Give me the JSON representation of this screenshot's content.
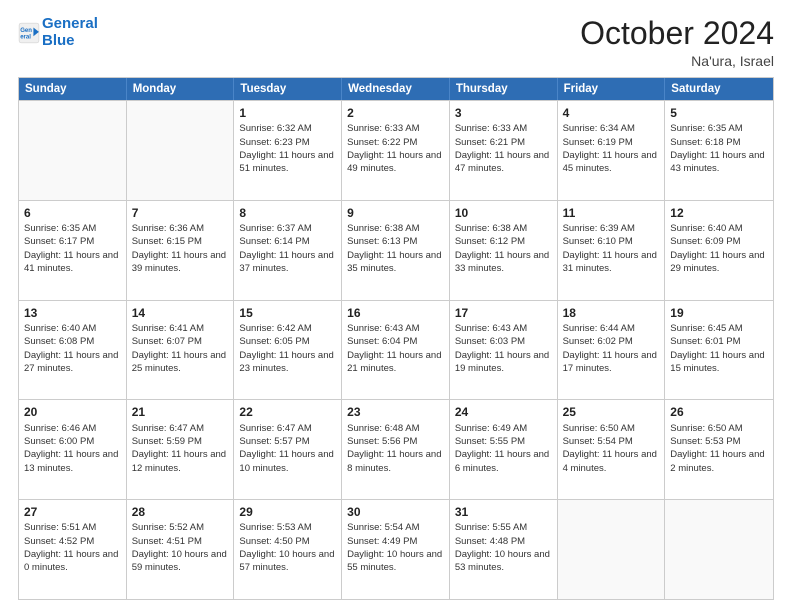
{
  "logo": {
    "line1": "General",
    "line2": "Blue"
  },
  "header": {
    "month": "October 2024",
    "location": "Na'ura, Israel"
  },
  "weekdays": [
    "Sunday",
    "Monday",
    "Tuesday",
    "Wednesday",
    "Thursday",
    "Friday",
    "Saturday"
  ],
  "weeks": [
    [
      {
        "day": "",
        "sunrise": "",
        "sunset": "",
        "daylight": ""
      },
      {
        "day": "",
        "sunrise": "",
        "sunset": "",
        "daylight": ""
      },
      {
        "day": "1",
        "sunrise": "Sunrise: 6:32 AM",
        "sunset": "Sunset: 6:23 PM",
        "daylight": "Daylight: 11 hours and 51 minutes."
      },
      {
        "day": "2",
        "sunrise": "Sunrise: 6:33 AM",
        "sunset": "Sunset: 6:22 PM",
        "daylight": "Daylight: 11 hours and 49 minutes."
      },
      {
        "day": "3",
        "sunrise": "Sunrise: 6:33 AM",
        "sunset": "Sunset: 6:21 PM",
        "daylight": "Daylight: 11 hours and 47 minutes."
      },
      {
        "day": "4",
        "sunrise": "Sunrise: 6:34 AM",
        "sunset": "Sunset: 6:19 PM",
        "daylight": "Daylight: 11 hours and 45 minutes."
      },
      {
        "day": "5",
        "sunrise": "Sunrise: 6:35 AM",
        "sunset": "Sunset: 6:18 PM",
        "daylight": "Daylight: 11 hours and 43 minutes."
      }
    ],
    [
      {
        "day": "6",
        "sunrise": "Sunrise: 6:35 AM",
        "sunset": "Sunset: 6:17 PM",
        "daylight": "Daylight: 11 hours and 41 minutes."
      },
      {
        "day": "7",
        "sunrise": "Sunrise: 6:36 AM",
        "sunset": "Sunset: 6:15 PM",
        "daylight": "Daylight: 11 hours and 39 minutes."
      },
      {
        "day": "8",
        "sunrise": "Sunrise: 6:37 AM",
        "sunset": "Sunset: 6:14 PM",
        "daylight": "Daylight: 11 hours and 37 minutes."
      },
      {
        "day": "9",
        "sunrise": "Sunrise: 6:38 AM",
        "sunset": "Sunset: 6:13 PM",
        "daylight": "Daylight: 11 hours and 35 minutes."
      },
      {
        "day": "10",
        "sunrise": "Sunrise: 6:38 AM",
        "sunset": "Sunset: 6:12 PM",
        "daylight": "Daylight: 11 hours and 33 minutes."
      },
      {
        "day": "11",
        "sunrise": "Sunrise: 6:39 AM",
        "sunset": "Sunset: 6:10 PM",
        "daylight": "Daylight: 11 hours and 31 minutes."
      },
      {
        "day": "12",
        "sunrise": "Sunrise: 6:40 AM",
        "sunset": "Sunset: 6:09 PM",
        "daylight": "Daylight: 11 hours and 29 minutes."
      }
    ],
    [
      {
        "day": "13",
        "sunrise": "Sunrise: 6:40 AM",
        "sunset": "Sunset: 6:08 PM",
        "daylight": "Daylight: 11 hours and 27 minutes."
      },
      {
        "day": "14",
        "sunrise": "Sunrise: 6:41 AM",
        "sunset": "Sunset: 6:07 PM",
        "daylight": "Daylight: 11 hours and 25 minutes."
      },
      {
        "day": "15",
        "sunrise": "Sunrise: 6:42 AM",
        "sunset": "Sunset: 6:05 PM",
        "daylight": "Daylight: 11 hours and 23 minutes."
      },
      {
        "day": "16",
        "sunrise": "Sunrise: 6:43 AM",
        "sunset": "Sunset: 6:04 PM",
        "daylight": "Daylight: 11 hours and 21 minutes."
      },
      {
        "day": "17",
        "sunrise": "Sunrise: 6:43 AM",
        "sunset": "Sunset: 6:03 PM",
        "daylight": "Daylight: 11 hours and 19 minutes."
      },
      {
        "day": "18",
        "sunrise": "Sunrise: 6:44 AM",
        "sunset": "Sunset: 6:02 PM",
        "daylight": "Daylight: 11 hours and 17 minutes."
      },
      {
        "day": "19",
        "sunrise": "Sunrise: 6:45 AM",
        "sunset": "Sunset: 6:01 PM",
        "daylight": "Daylight: 11 hours and 15 minutes."
      }
    ],
    [
      {
        "day": "20",
        "sunrise": "Sunrise: 6:46 AM",
        "sunset": "Sunset: 6:00 PM",
        "daylight": "Daylight: 11 hours and 13 minutes."
      },
      {
        "day": "21",
        "sunrise": "Sunrise: 6:47 AM",
        "sunset": "Sunset: 5:59 PM",
        "daylight": "Daylight: 11 hours and 12 minutes."
      },
      {
        "day": "22",
        "sunrise": "Sunrise: 6:47 AM",
        "sunset": "Sunset: 5:57 PM",
        "daylight": "Daylight: 11 hours and 10 minutes."
      },
      {
        "day": "23",
        "sunrise": "Sunrise: 6:48 AM",
        "sunset": "Sunset: 5:56 PM",
        "daylight": "Daylight: 11 hours and 8 minutes."
      },
      {
        "day": "24",
        "sunrise": "Sunrise: 6:49 AM",
        "sunset": "Sunset: 5:55 PM",
        "daylight": "Daylight: 11 hours and 6 minutes."
      },
      {
        "day": "25",
        "sunrise": "Sunrise: 6:50 AM",
        "sunset": "Sunset: 5:54 PM",
        "daylight": "Daylight: 11 hours and 4 minutes."
      },
      {
        "day": "26",
        "sunrise": "Sunrise: 6:50 AM",
        "sunset": "Sunset: 5:53 PM",
        "daylight": "Daylight: 11 hours and 2 minutes."
      }
    ],
    [
      {
        "day": "27",
        "sunrise": "Sunrise: 5:51 AM",
        "sunset": "Sunset: 4:52 PM",
        "daylight": "Daylight: 11 hours and 0 minutes."
      },
      {
        "day": "28",
        "sunrise": "Sunrise: 5:52 AM",
        "sunset": "Sunset: 4:51 PM",
        "daylight": "Daylight: 10 hours and 59 minutes."
      },
      {
        "day": "29",
        "sunrise": "Sunrise: 5:53 AM",
        "sunset": "Sunset: 4:50 PM",
        "daylight": "Daylight: 10 hours and 57 minutes."
      },
      {
        "day": "30",
        "sunrise": "Sunrise: 5:54 AM",
        "sunset": "Sunset: 4:49 PM",
        "daylight": "Daylight: 10 hours and 55 minutes."
      },
      {
        "day": "31",
        "sunrise": "Sunrise: 5:55 AM",
        "sunset": "Sunset: 4:48 PM",
        "daylight": "Daylight: 10 hours and 53 minutes."
      },
      {
        "day": "",
        "sunrise": "",
        "sunset": "",
        "daylight": ""
      },
      {
        "day": "",
        "sunrise": "",
        "sunset": "",
        "daylight": ""
      }
    ]
  ]
}
